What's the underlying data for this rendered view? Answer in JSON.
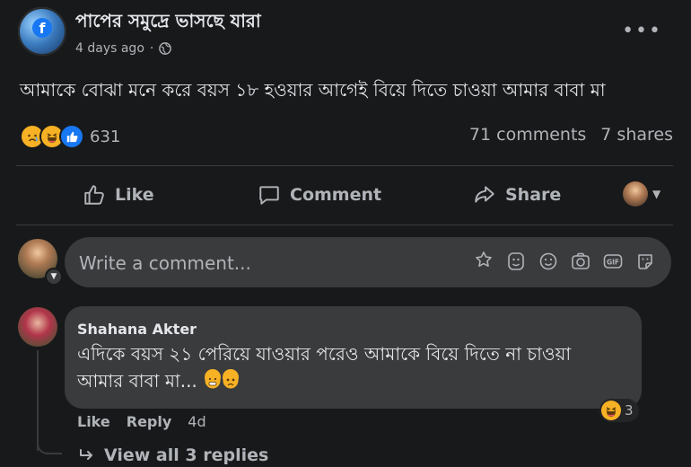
{
  "post": {
    "page_name": "পাপের সমুদ্রে ভাসছে যারা",
    "time": "4 days ago",
    "separator": "·",
    "text": "আমাকে বোঝা মনে করে বয়স ১৮ হওয়ার আগেই বিয়ে দিতে চাওয়া আমার বাবা মা",
    "more_label": "•••"
  },
  "stats": {
    "reaction_icons": [
      "sad-face-icon",
      "haha-face-icon",
      "like-thumb-icon"
    ],
    "reaction_count": "631",
    "comments": "71 comments",
    "shares": "7 shares"
  },
  "actions": {
    "like": "Like",
    "comment": "Comment",
    "share": "Share"
  },
  "composer": {
    "placeholder": "Write a comment...",
    "tools": [
      "avatar-sticker-icon",
      "sticker-icon",
      "emoji-icon",
      "camera-icon",
      "gif-icon",
      "sticker-face-icon"
    ]
  },
  "comment": {
    "author": "Shahana Akter",
    "text": "এদিকে বয়স ২১ পেরিয়ে যাওয়ার পরেও আমাকে বিয়ে দিতে না চাওয়া আমার বাবা মা...",
    "like": "Like",
    "reply": "Reply",
    "age": "4d",
    "reaction_count": "3",
    "view_replies": "View all 3 replies"
  },
  "colors": {
    "background": "#18191a",
    "surface": "#3a3b3c",
    "text": "#e4e6eb",
    "muted": "#b0b3b8",
    "brand": "#1877f2"
  }
}
